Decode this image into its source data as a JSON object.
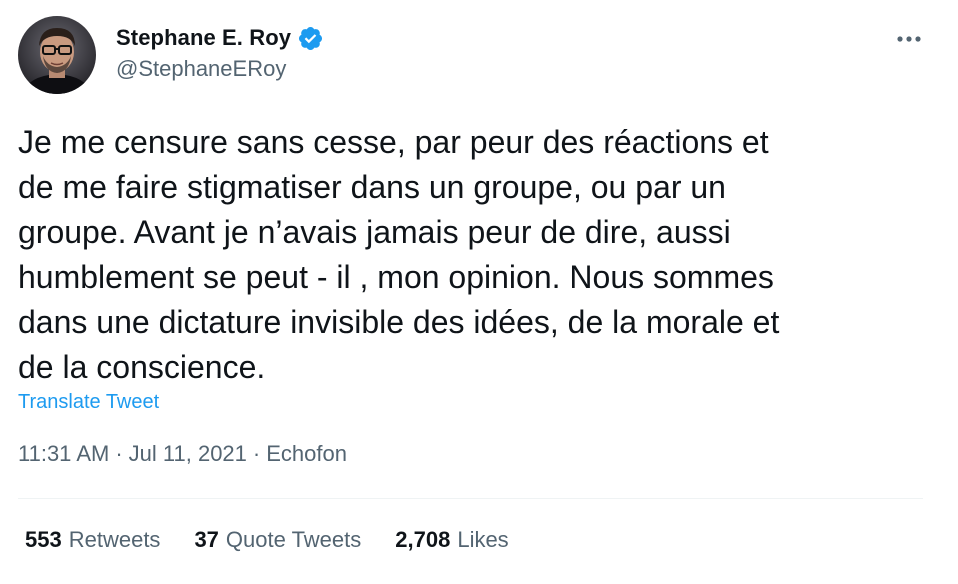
{
  "author": {
    "display_name": "Stephane E. Roy",
    "handle": "@StephaneERoy",
    "verified": true,
    "avatar": "profile-photo"
  },
  "tweet": {
    "text": "Je me censure sans cesse, par peur des réactions et\nde me faire stigmatiser dans un groupe, ou par un\ngroupe. Avant je n’avais jamais peur de dire, aussi\nhumblement se peut - il , mon opinion. Nous sommes\ndans une dictature invisible des idées, de la morale et\nde la conscience.",
    "translate_label": "Translate Tweet",
    "time": "11:31 AM",
    "date": "Jul 11, 2021",
    "source": "Echofon",
    "separator": "·"
  },
  "stats": [
    {
      "count": "553",
      "label": "Retweets"
    },
    {
      "count": "37",
      "label": "Quote Tweets"
    },
    {
      "count": "2,708",
      "label": "Likes"
    }
  ],
  "icons": {
    "verified": "verified-badge-icon",
    "more": "more-options-icon"
  },
  "colors": {
    "text_primary": "#0f1419",
    "text_secondary": "#536471",
    "accent": "#1d9bf0",
    "divider": "#eff3f4"
  }
}
